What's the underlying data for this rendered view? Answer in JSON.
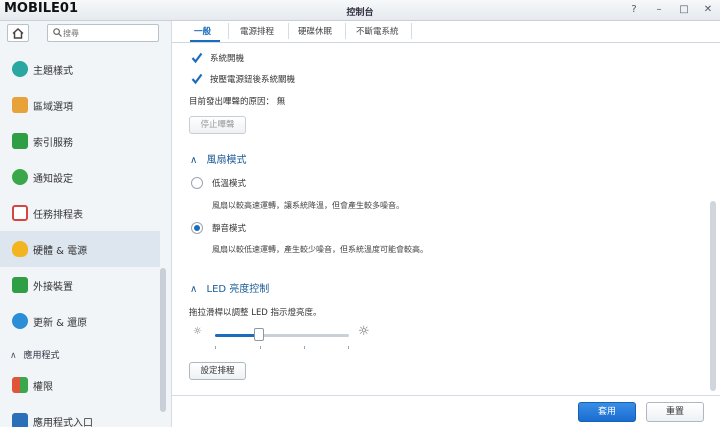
{
  "watermark": "MOBILE01",
  "window": {
    "title": "控制台",
    "buttons": [
      "?",
      "–",
      "□",
      "✕"
    ]
  },
  "sidebar": {
    "search_placeholder": "搜尋",
    "items": [
      {
        "label": "主題樣式",
        "icon": "palette-icon",
        "color": "#2aa7a0"
      },
      {
        "label": "區域選項",
        "icon": "calendar-clock-icon",
        "color": "#e8a23a"
      },
      {
        "label": "索引服務",
        "icon": "index-search-icon",
        "color": "#2f9e44"
      },
      {
        "label": "通知設定",
        "icon": "chat-bubble-icon",
        "color": "#3aa84a"
      },
      {
        "label": "任務排程表",
        "icon": "task-calendar-icon",
        "color": "#d64541"
      },
      {
        "label": "硬體 & 電源",
        "icon": "lightbulb-icon",
        "color": "#f2b51f"
      },
      {
        "label": "外接裝置",
        "icon": "upload-arrow-icon",
        "color": "#2f9e44"
      },
      {
        "label": "更新 & 還原",
        "icon": "refresh-icon",
        "color": "#2a8fd6"
      }
    ],
    "section_label": "應用程式",
    "app_items": [
      {
        "label": "權限",
        "icon": "grid-permission-icon",
        "color": "#e0543a"
      },
      {
        "label": "應用程式入口",
        "icon": "app-portal-icon",
        "color": "#2a6fb8"
      }
    ]
  },
  "tabs": [
    "一般",
    "電源排程",
    "硬碟休眠",
    "不斷電系統"
  ],
  "general": {
    "checkbox1": "系統開機",
    "checkbox2": "按壓電源鈕後系統關機",
    "beep_reason": "目前發出嗶聲的原因： 無",
    "stop_beep": "停止嗶聲"
  },
  "fan": {
    "title": "風扇模式",
    "cool_label": "低溫模式",
    "cool_desc": "風扇以較高速運轉，讓系統降溫，但會產生較多噪音。",
    "quiet_label": "靜音模式",
    "quiet_desc": "風扇以較低速運轉，產生較少噪音，但系統溫度可能會較高。",
    "selected": "quiet"
  },
  "led": {
    "title": "LED 亮度控制",
    "desc": "拖拉滑桿以調整 LED 指示燈亮度。",
    "level": 0.33,
    "schedule_button": "設定排程"
  },
  "footer": {
    "apply": "套用",
    "reset": "重置"
  },
  "colors": {
    "accent": "#1a6dbd",
    "section_title": "#1a5a96"
  }
}
